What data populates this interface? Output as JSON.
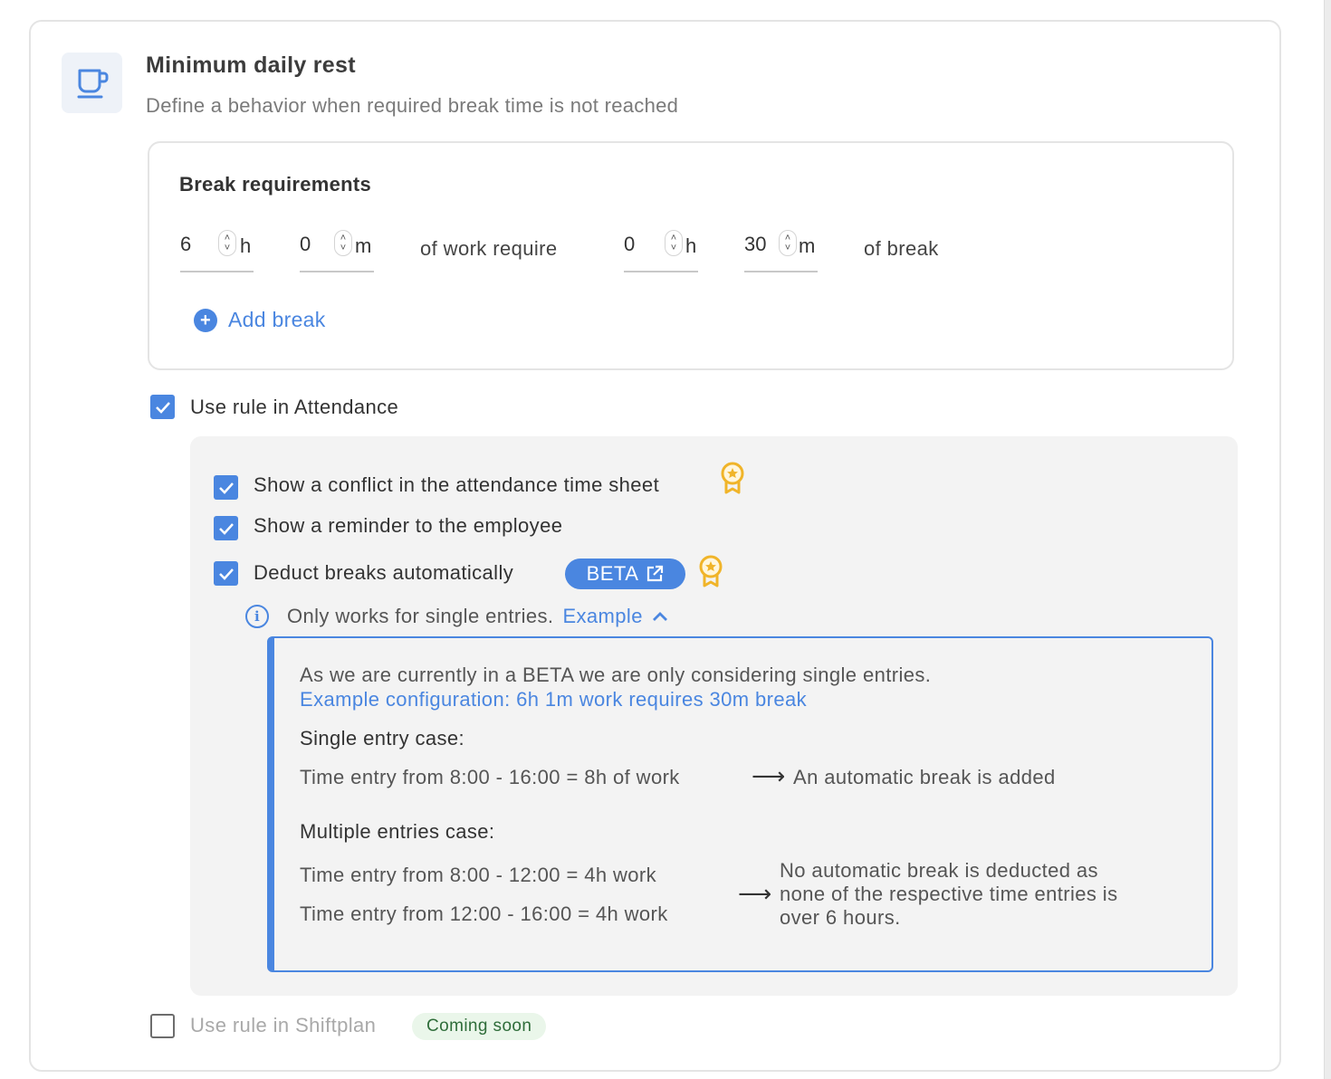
{
  "section": {
    "icon": "coffee-cup-icon",
    "title": "Minimum daily rest",
    "subtitle": "Define a behavior when required break time is not reached"
  },
  "break_requirements": {
    "title": "Break requirements",
    "work_hours": {
      "value": "6",
      "unit": "h"
    },
    "work_minutes": {
      "value": "0",
      "unit": "m"
    },
    "middle_text": "of work require",
    "break_hours": {
      "value": "0",
      "unit": "h"
    },
    "break_minutes": {
      "value": "30",
      "unit": "m"
    },
    "end_text": "of break",
    "add_break_label": "Add break"
  },
  "attendance": {
    "label": "Use rule in Attendance",
    "checked": true,
    "options": [
      {
        "label": "Show a conflict in the attendance time sheet",
        "checked": true
      },
      {
        "label": "Show a reminder to the employee",
        "checked": true
      },
      {
        "label": "Deduct breaks automatically",
        "checked": true
      }
    ],
    "beta_label": "BETA",
    "info_text": "Only works for single entries.",
    "example_link": "Example"
  },
  "example": {
    "intro": "As we are currently in a BETA we are only considering single entries.",
    "config": "Example configuration: 6h 1m work requires 30m break",
    "single_title": "Single entry case:",
    "single_entry": "Time entry from 8:00 - 16:00 = 8h of work",
    "single_result": "An automatic break is added",
    "multi_title": "Multiple entries case:",
    "multi_entry_1": "Time entry from 8:00 - 12:00 = 4h work",
    "multi_entry_2": "Time entry from 12:00 - 16:00 = 4h work",
    "multi_result_1": "No automatic break is deducted as",
    "multi_result_2": "none of the respective time entries is",
    "multi_result_3": "over 6 hours.",
    "arrow": "⟶"
  },
  "shiftplan": {
    "label": "Use rule in Shiftplan",
    "checked": false,
    "badge": "Coming soon"
  },
  "colors": {
    "accent": "#4a86e0",
    "award": "#f0b429",
    "badge_green_bg": "#eaf6ea"
  }
}
